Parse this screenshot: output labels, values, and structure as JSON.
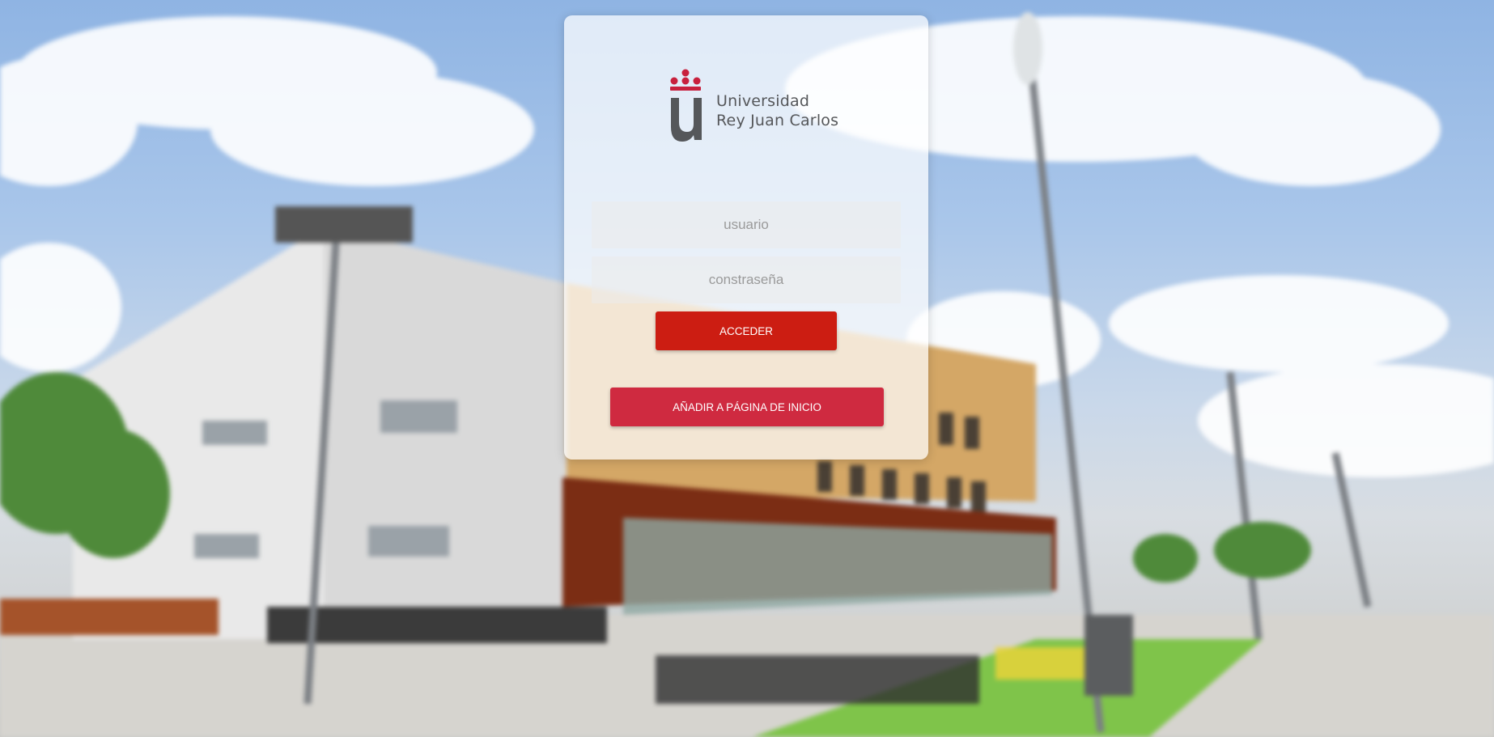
{
  "logo": {
    "line1": "Universidad",
    "line2": "Rey Juan Carlos",
    "mark_icon": "urjc-crowned-u-icon",
    "mark_color": "#c8203d",
    "letter_color": "#55575a"
  },
  "login": {
    "username_placeholder": "usuario",
    "password_placeholder": "constraseña",
    "submit_label": "ACCEDER"
  },
  "home_button_label": "AÑADIR A PÁGINA DE INICIO",
  "colors": {
    "login_button": "#cc1d12",
    "home_button": "#c80a28"
  }
}
